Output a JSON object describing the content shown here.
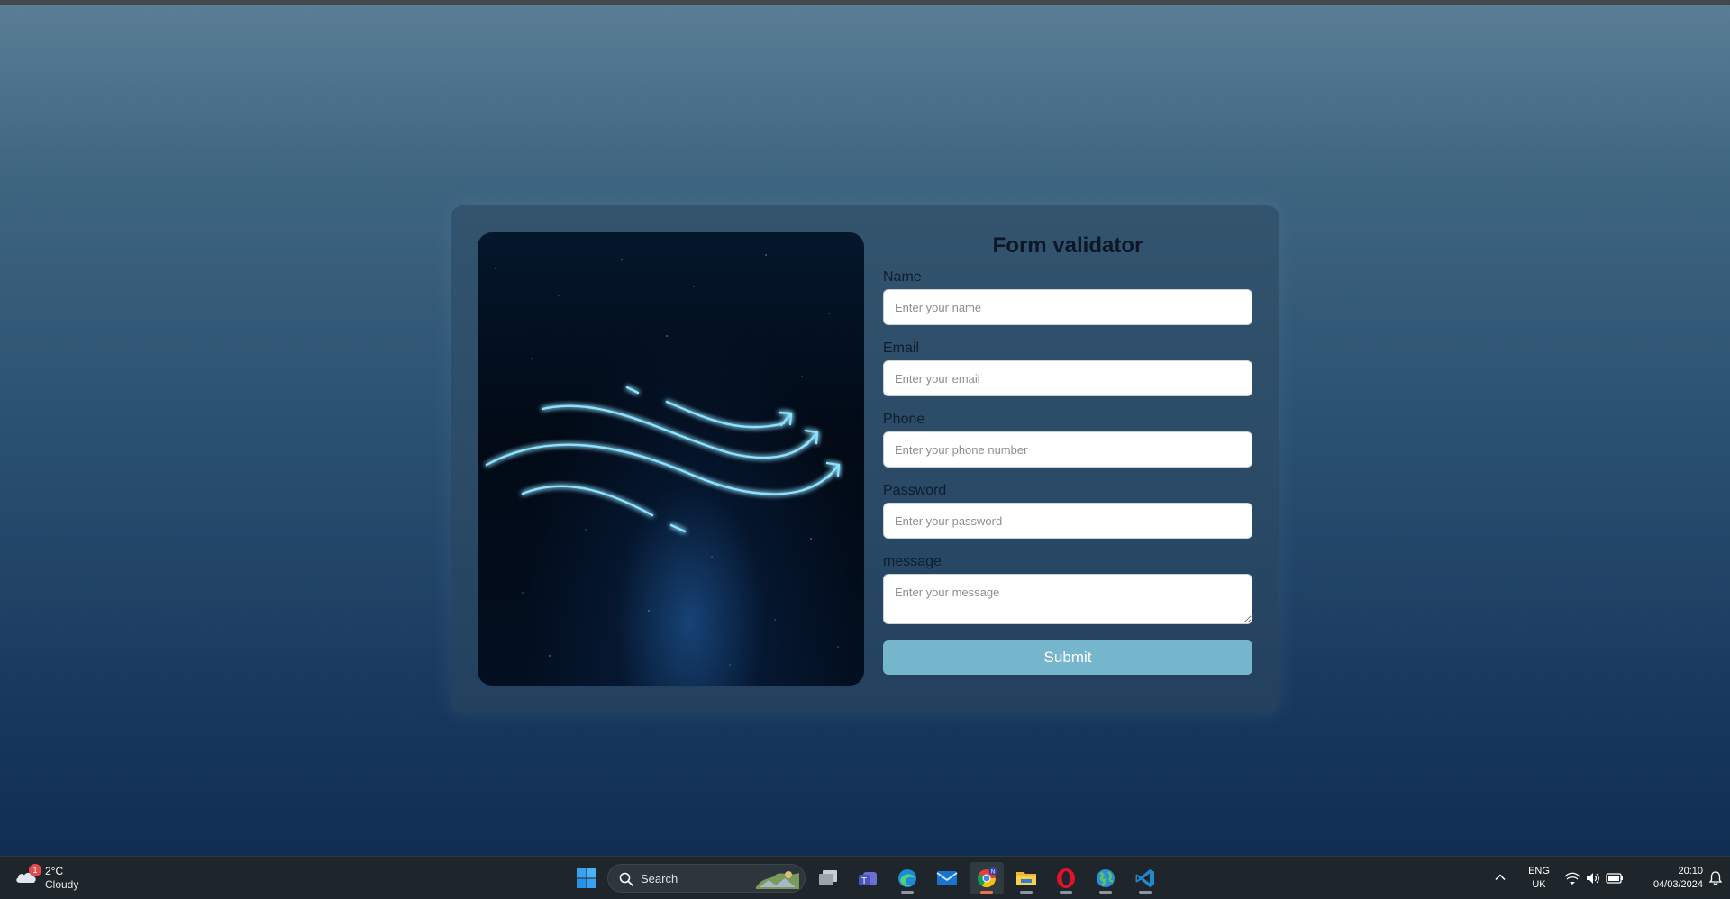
{
  "form": {
    "title": "Form validator",
    "fields": [
      {
        "label": "Name",
        "placeholder": "Enter your name"
      },
      {
        "label": "Email",
        "placeholder": "Enter your email"
      },
      {
        "label": "Phone",
        "placeholder": "Enter your phone number"
      },
      {
        "label": "Password",
        "placeholder": "Enter your password"
      }
    ],
    "message": {
      "label": "message",
      "placeholder": "Enter your message"
    },
    "submit_label": "Submit"
  },
  "colors": {
    "submit_bg": "#76b6cc",
    "glow_line": "#7fd8ff",
    "badge": "#e24b4b"
  },
  "taskbar": {
    "weather": {
      "badge": "1",
      "temp": "2°C",
      "condition": "Cloudy"
    },
    "search_label": "Search",
    "apps": [
      "windows-start-icon",
      "task-view-icon",
      "teams-icon",
      "edge-icon",
      "mail-icon",
      "chrome-icon",
      "file-explorer-icon",
      "opera-icon",
      "browser-globe-icon",
      "vscode-icon"
    ],
    "chrome_badge": "N",
    "language": {
      "lang": "ENG",
      "region": "UK"
    },
    "clock": {
      "time": "20:10",
      "date": "04/03/2024"
    }
  }
}
